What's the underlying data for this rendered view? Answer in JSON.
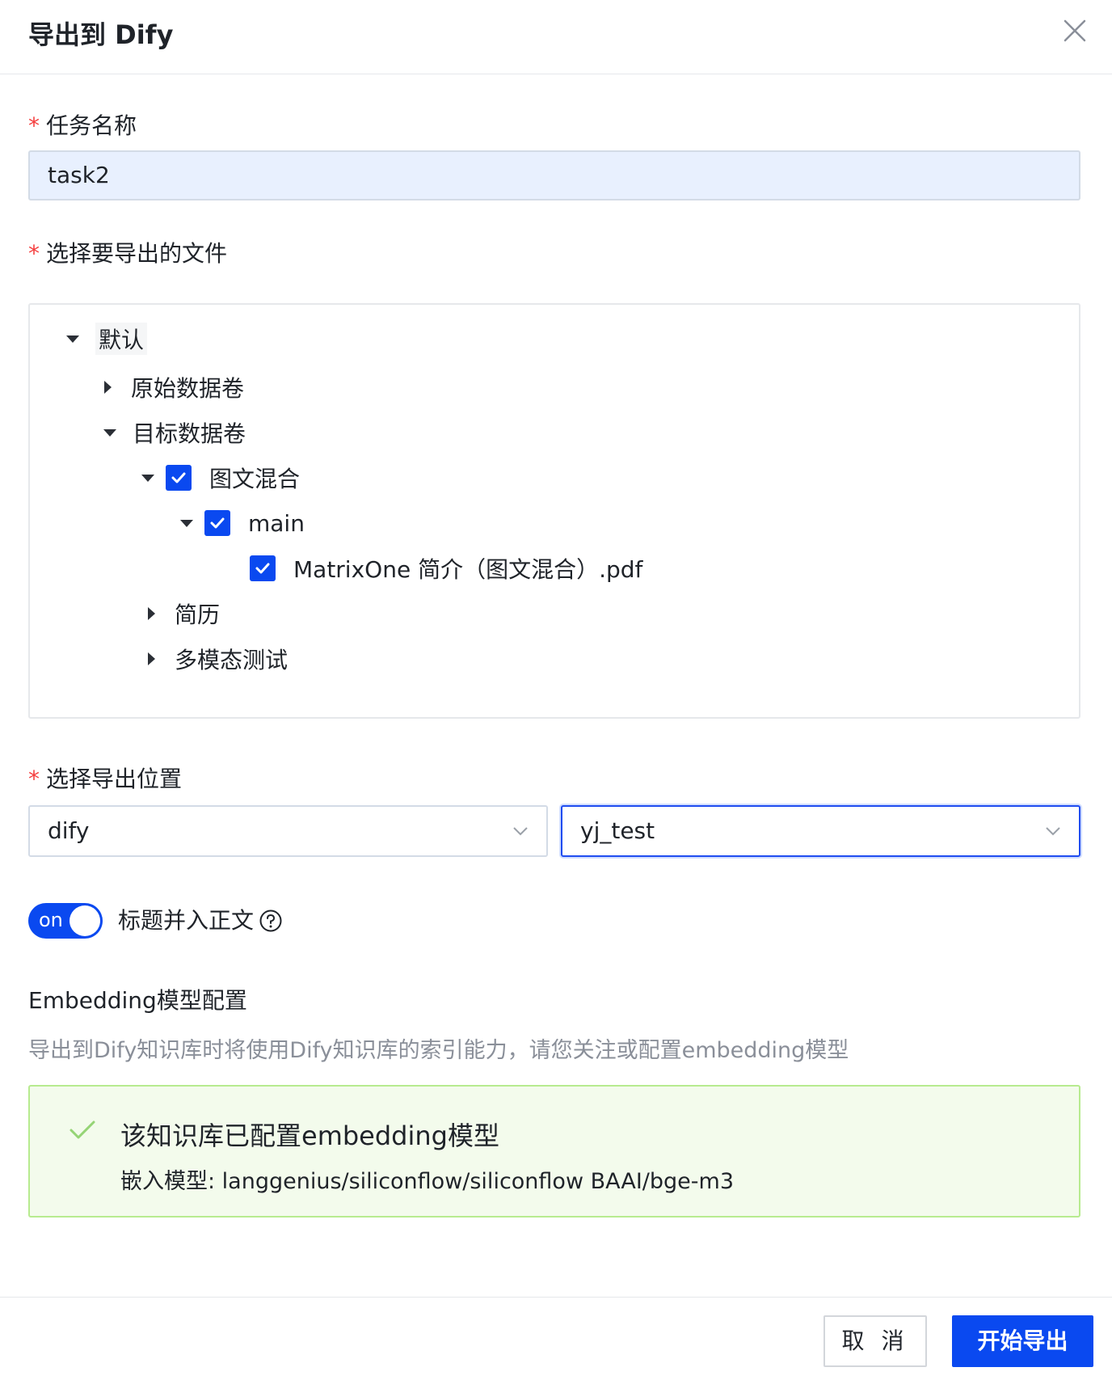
{
  "dialog": {
    "title": "导出到 Dify"
  },
  "task_name": {
    "label": "任务名称",
    "value": "task2"
  },
  "files": {
    "label": "选择要导出的文件",
    "tree": {
      "root": "默认",
      "source_volume": "原始数据卷",
      "target_volume": "目标数据卷",
      "mixed": "图文混合",
      "main": "main",
      "file": "MatrixOne 简介（图文混合）.pdf",
      "resume": "简历",
      "multimodal": "多模态测试"
    }
  },
  "location": {
    "label": "选择导出位置",
    "platform": "dify",
    "dataset": "yj_test"
  },
  "toggle": {
    "state": "on",
    "label": "标题并入正文"
  },
  "embedding": {
    "title": "Embedding模型配置",
    "description": "导出到Dify知识库时将使用Dify知识库的索引能力，请您关注或配置embedding模型",
    "alert_title": "该知识库已配置embedding模型",
    "alert_detail": "嵌入模型: langgenius/siliconflow/siliconflow BAAI/bge-m3"
  },
  "footer": {
    "cancel": "取 消",
    "submit": "开始导出"
  },
  "colors": {
    "primary": "#0a49f0",
    "required": "#f53f3f",
    "success": "#52c41a"
  },
  "icons": {
    "close": "close-icon",
    "check": "check-icon",
    "chevron": "chevron-down-icon",
    "help": "question-circle-icon"
  }
}
